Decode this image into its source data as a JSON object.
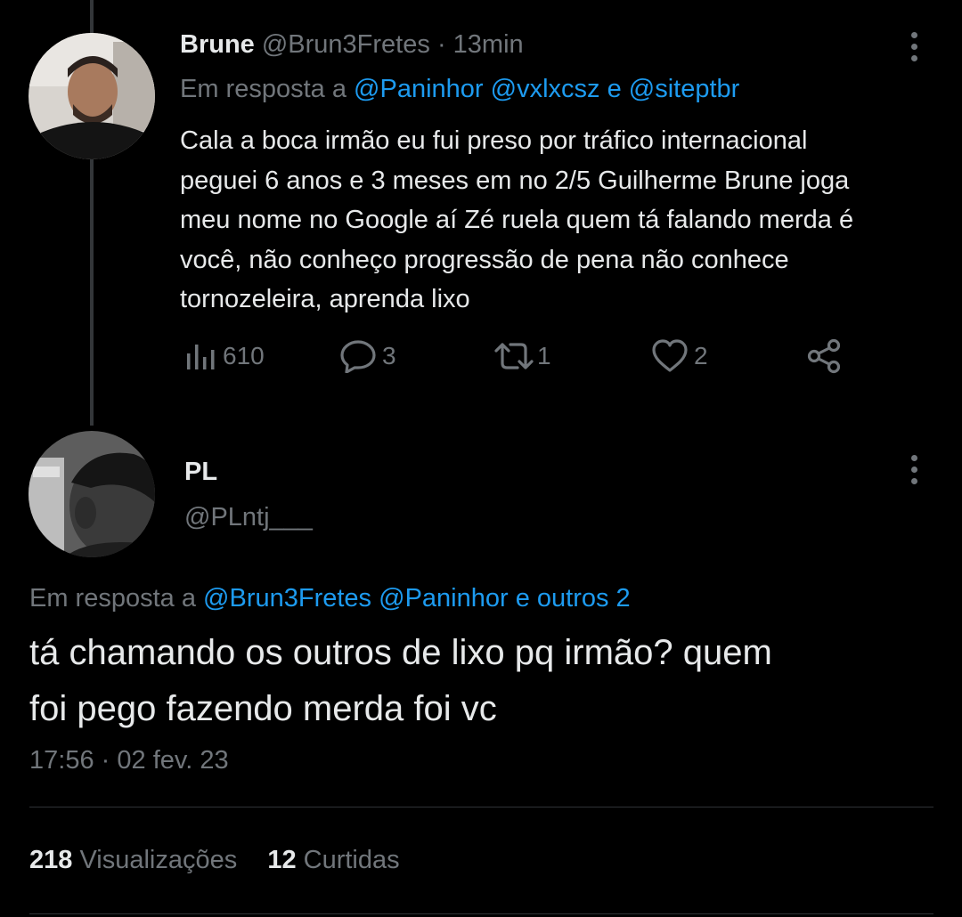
{
  "tweet1": {
    "display_name": "Brune",
    "handle": "@Brun3Fretes",
    "separator": "·",
    "time": "13min",
    "reply_prefix": "Em resposta a",
    "reply_mentions": [
      "@Paninhor",
      "@vxlxcsz"
    ],
    "reply_conjunction": "e",
    "reply_last": "@siteptbr",
    "text_lines": [
      "Cala a boca irmão eu fui preso por tráfico internacional",
      "peguei 6 anos e 3 meses em no 2/5 Guilherme Brune joga",
      "meu nome no Google aí Zé ruela quem tá falando merda é",
      "você, não conheço progressão de pena não conhece",
      "tornozeleira, aprenda lixo"
    ],
    "actions": {
      "views": "610",
      "replies": "3",
      "retweets": "1",
      "likes": "2"
    },
    "icons": [
      "views-icon",
      "reply-icon",
      "retweet-icon",
      "like-icon",
      "share-icon",
      "more-icon"
    ]
  },
  "tweet2": {
    "display_name": "PL",
    "handle": "@PLntj___",
    "reply_prefix": "Em resposta a",
    "reply_mention_1": "@Brun3Fretes",
    "reply_mention_2": "@Paninhor",
    "reply_others": "e outros 2",
    "text_lines": [
      "tá chamando os outros de lixo pq irmão? quem",
      "foi pego fazendo merda foi vc"
    ],
    "timestamp_time": "17:56",
    "timestamp_sep": "·",
    "timestamp_date": "02 fev. 23",
    "stats": {
      "views_count": "218",
      "views_label": "Visualizações",
      "likes_count": "12",
      "likes_label": "Curtidas"
    }
  },
  "colors": {
    "background": "#000000",
    "text": "#e7e9ea",
    "muted": "#71767b",
    "link": "#1d9bf0",
    "divider": "#2f3336"
  }
}
